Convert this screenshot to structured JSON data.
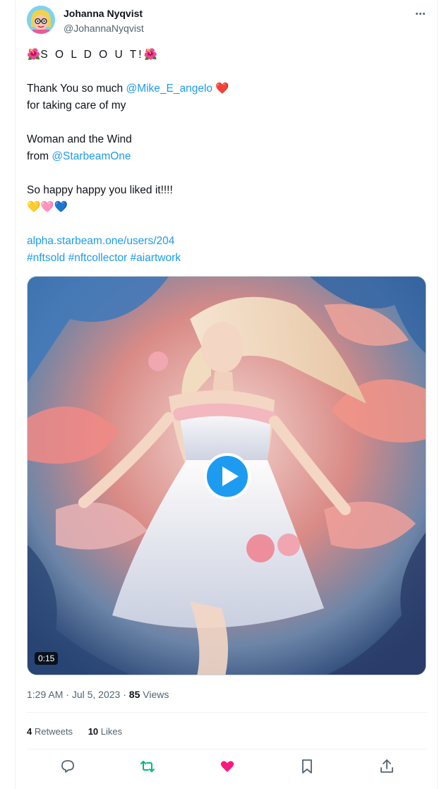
{
  "author": {
    "name": "Johanna Nyqvist",
    "handle": "@JohannaNyqvist"
  },
  "tweet": {
    "sold_out": "S O L D  O U T!",
    "line1_prefix": "Thank You so much ",
    "mention1": "@Mike_E_angelo",
    "line2": "for taking care of my",
    "line3": "Woman and the Wind",
    "line4_prefix": "from ",
    "mention2": "@StarbeamOne",
    "line5": "So happy happy you liked it!!!!",
    "url": "alpha.starbeam.one/users/204",
    "hashtags": [
      "#nftsold",
      "#nftcollector",
      "#aiartwork"
    ]
  },
  "media": {
    "duration": "0:15"
  },
  "meta": {
    "time": "1:29 AM",
    "date": "Jul 5, 2023",
    "views_count": "85",
    "views_label": "Views"
  },
  "stats": {
    "retweets_count": "4",
    "retweets_label": "Retweets",
    "likes_count": "10",
    "likes_label": "Likes"
  },
  "colors": {
    "link": "#1d9bf0",
    "like": "#f91880",
    "retweet": "#00ba7c"
  }
}
